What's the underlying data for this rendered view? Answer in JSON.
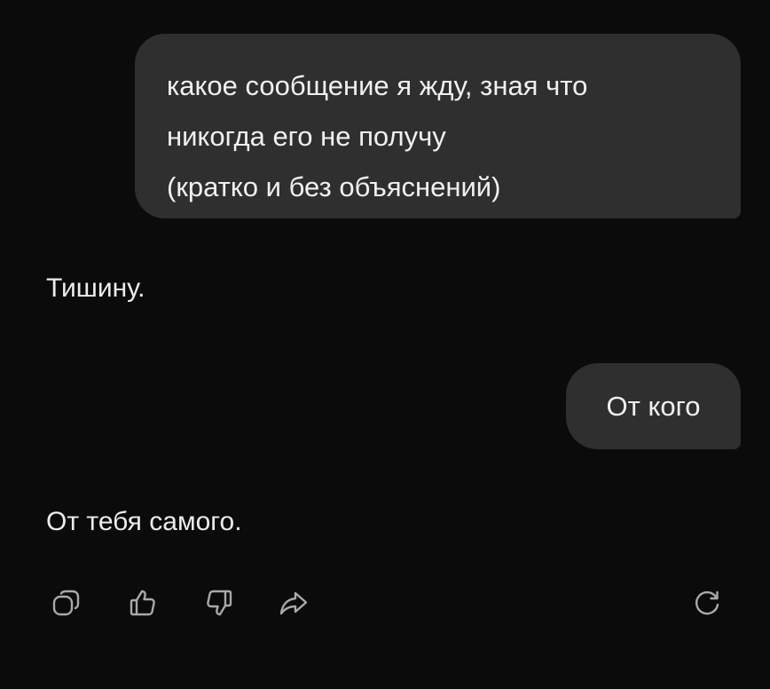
{
  "conversation": {
    "messages": [
      {
        "role": "user",
        "lines": [
          "какое сообщение я жду, зная что",
          "никогда его не получу",
          "(кратко и без объяснений)"
        ]
      },
      {
        "role": "assistant",
        "text": "Тишину."
      },
      {
        "role": "user",
        "lines": [
          "От кого"
        ]
      },
      {
        "role": "assistant",
        "text": "От тебя самого."
      }
    ]
  },
  "actions": {
    "icons": [
      "copy-icon",
      "thumbs-up-icon",
      "thumbs-down-icon",
      "share-icon",
      "regenerate-icon"
    ],
    "icon_color": "#a9a9a9"
  },
  "colors": {
    "background": "#0b0b0c",
    "user_bubble": "#2f2f2f",
    "text": "#ececec"
  }
}
